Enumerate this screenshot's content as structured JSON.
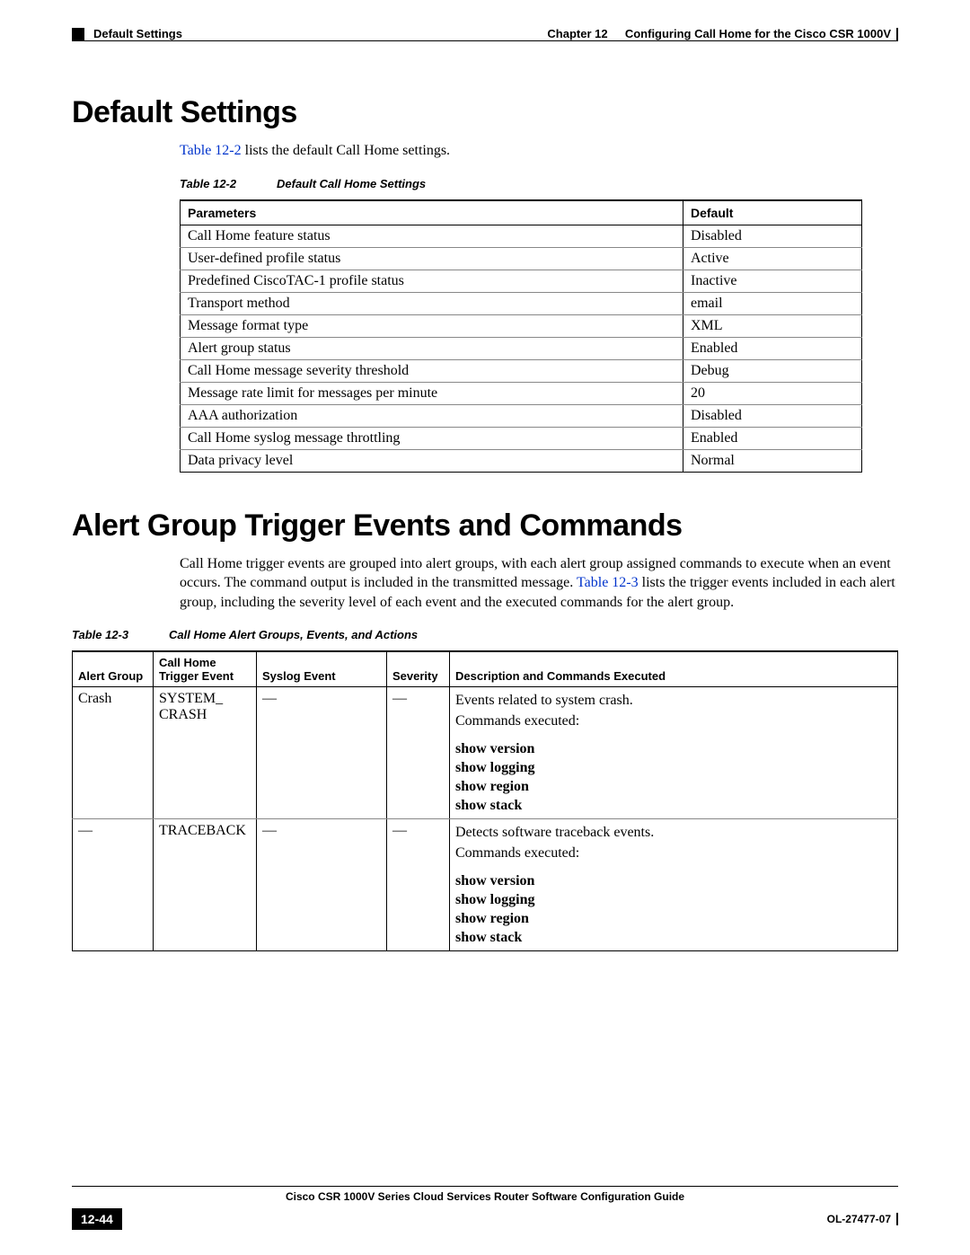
{
  "header": {
    "section": "Default Settings",
    "chapter_label": "Chapter 12",
    "chapter_title": "Configuring Call Home for the Cisco CSR 1000V"
  },
  "h1_a": "Default Settings",
  "intro1_pre": "Table 12-2",
  "intro1_post": " lists the default Call Home settings.",
  "table1": {
    "caption_label": "Table 12-2",
    "caption_title": "Default Call Home Settings",
    "col_param": "Parameters",
    "col_default": "Default",
    "rows": [
      {
        "p": "Call Home feature status",
        "d": "Disabled"
      },
      {
        "p": "User-defined profile status",
        "d": "Active"
      },
      {
        "p": "Predefined CiscoTAC-1  profile status",
        "d": "Inactive"
      },
      {
        "p": "Transport method",
        "d": "email"
      },
      {
        "p": "Message format type",
        "d": "XML"
      },
      {
        "p": "Alert group status",
        "d": "Enabled"
      },
      {
        "p": "Call Home message severity threshold",
        "d": "Debug"
      },
      {
        "p": "Message rate limit for messages per minute",
        "d": "20"
      },
      {
        "p": "AAA authorization",
        "d": "Disabled"
      },
      {
        "p": "Call Home syslog message throttling",
        "d": "Enabled"
      },
      {
        "p": "Data privacy level",
        "d": "Normal"
      }
    ]
  },
  "h1_b": "Alert Group Trigger Events and Commands",
  "intro2_a": "Call Home trigger events are grouped into alert groups, with each alert group assigned commands to execute when an event occurs. The command output is included in the transmitted message. ",
  "intro2_link": "Table 12-3",
  "intro2_b": " lists the trigger events included in each alert group, including the severity level of each event and the executed commands for the alert group.",
  "table2": {
    "caption_label": "Table 12-3",
    "caption_title": "Call Home Alert Groups, Events, and Actions",
    "headers": {
      "alert_group": "Alert Group",
      "trigger_event_top": "Call Home",
      "trigger_event_bot": "Trigger Event",
      "syslog_event": "Syslog Event",
      "severity": "Severity",
      "desc": "Description and Commands Executed"
    },
    "rows": [
      {
        "ag": "Crash",
        "te_a": "SYSTEM_",
        "te_b": "CRASH",
        "se": "—",
        "sv": "—",
        "desc1": "Events related to system crash.",
        "desc2": "Commands executed:",
        "cmd1": "show version",
        "cmd2": "show logging",
        "cmd3": "show region",
        "cmd4": "show stack"
      },
      {
        "ag": "—",
        "te_a": "TRACEBACK",
        "te_b": "",
        "se": "—",
        "sv": "—",
        "desc1": "Detects software traceback events.",
        "desc2": "Commands executed:",
        "cmd1": "show version",
        "cmd2": "show logging",
        "cmd3": "show region",
        "cmd4": "show stack"
      }
    ]
  },
  "footer": {
    "guide": "Cisco CSR 1000V Series Cloud Services Router Software Configuration Guide",
    "page": "12-44",
    "doc_id": "OL-27477-07"
  }
}
